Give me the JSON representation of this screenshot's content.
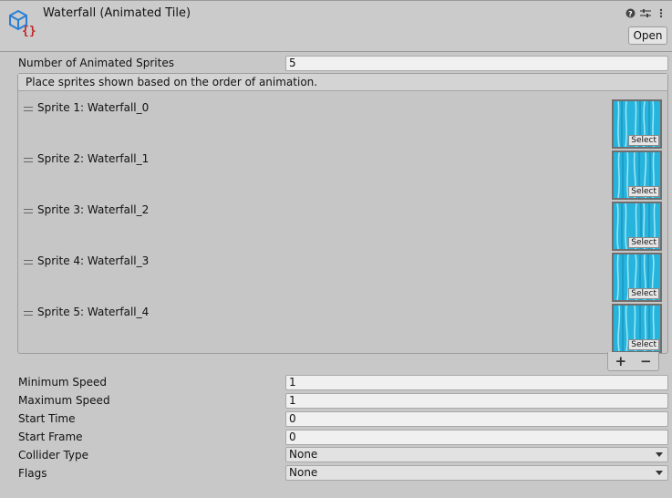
{
  "header": {
    "title": "Waterfall (Animated Tile)",
    "open_label": "Open",
    "icons": [
      "help-icon",
      "preset-icon",
      "more-options-icon"
    ]
  },
  "num_sprites": {
    "label": "Number of Animated Sprites",
    "value": "5"
  },
  "sprite_list": {
    "header": "Place sprites shown based on the order of animation.",
    "select_label": "Select",
    "items": [
      {
        "label": "Sprite 1: Waterfall_0"
      },
      {
        "label": "Sprite 2: Waterfall_1"
      },
      {
        "label": "Sprite 3: Waterfall_2"
      },
      {
        "label": "Sprite 4: Waterfall_3"
      },
      {
        "label": "Sprite 5: Waterfall_4"
      }
    ],
    "add_label": "+",
    "remove_label": "−"
  },
  "fields": {
    "min_speed": {
      "label": "Minimum Speed",
      "value": "1"
    },
    "max_speed": {
      "label": "Maximum Speed",
      "value": "1"
    },
    "start_time": {
      "label": "Start Time",
      "value": "0"
    },
    "start_frame": {
      "label": "Start Frame",
      "value": "0"
    },
    "collider_type": {
      "label": "Collider Type",
      "value": "None"
    },
    "flags": {
      "label": "Flags",
      "value": "None"
    }
  },
  "colors": {
    "background": "#c8c8c8",
    "water": "#28b6de",
    "icon_red": "#c0262a",
    "icon_blue": "#2a7fd4"
  }
}
